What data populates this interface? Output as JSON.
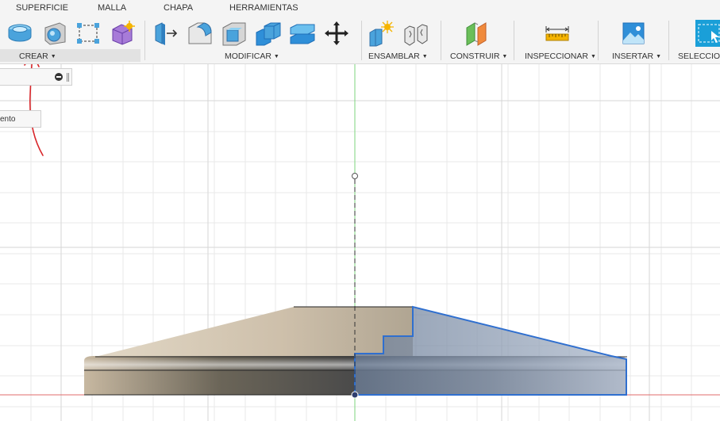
{
  "toolbar": {
    "tabs": [
      "SUPERFICIE",
      "MALLA",
      "CHAPA",
      "HERRAMIENTAS"
    ],
    "groups": {
      "create": "CREAR",
      "modify": "MODIFICAR",
      "assemble": "ENSAMBLAR",
      "construct": "CONSTRUIR",
      "inspect": "INSPECCIONAR",
      "insert": "INSERTAR",
      "select": "SELECCIONAR"
    },
    "icons": {
      "create": [
        "extrude-icon",
        "revolve-icon",
        "sketch-rectangle-icon",
        "form-icon"
      ],
      "modify": [
        "press-pull-icon",
        "fillet-icon",
        "shell-icon",
        "combine-icon",
        "split-body-icon",
        "move-icon"
      ],
      "assemble": [
        "new-component-icon",
        "joint-icon"
      ],
      "construct": [
        "offset-plane-icon"
      ],
      "inspect": [
        "measure-icon"
      ],
      "insert": [
        "insert-image-icon"
      ],
      "select": [
        "select-icon"
      ]
    },
    "accent_color": "#1a9fd8"
  },
  "browser": {
    "item_label": "ento"
  },
  "canvas": {
    "grid_color": "#e8e8e8",
    "x_axis_color": "#e06b6b",
    "y_axis_color": "#7cd67c",
    "profile_color": "#2f6fcf",
    "annotation_color": "#d8262a"
  }
}
